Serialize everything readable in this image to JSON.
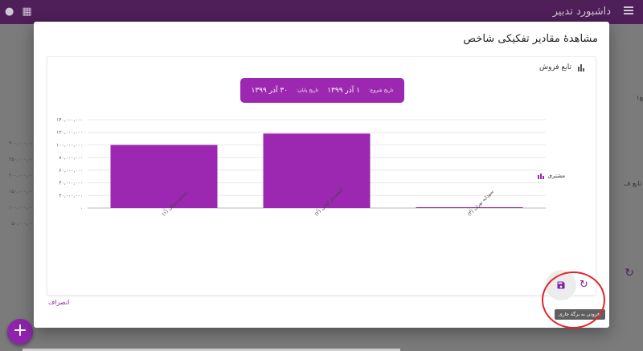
{
  "app": {
    "title": "داشبورد تدبیر",
    "menu_icon": "menu-icon",
    "left_icons": [
      "user-icon",
      "apps-icon"
    ]
  },
  "background": {
    "axis_labels": [
      "۳۰۰,۰۰۰,۰۰۰",
      "۲۵۰,۰۰۰,۰۰۰",
      "۲۰۰,۰۰۰,۰۰۰",
      "۱۵۰,۰۰۰,۰۰۰",
      "۱۰۰,۰۰۰,۰۰۰",
      "۵۰,۰۰۰,۰۰۰"
    ],
    "right_text_1": "۱‍ع",
    "right_text_2": "تابع ف",
    "fab_label": "+"
  },
  "dialog": {
    "title": "مشاهدهٔ مقادیر تفکیکی شاخص",
    "card_title": "تابع فروش",
    "date_range": {
      "start_label": "تاریخ شروع:",
      "start_value": "۱ آذر ۱۳۹۹",
      "end_label": "تاریخ پایان:",
      "end_value": "۳۰ آذر ۱۳۹۹"
    },
    "legend_label": "مشتری",
    "tooltip": "افزودن به برگهٔ جاری",
    "cancel_label": "انصراف",
    "accent_color": "#9c27b0"
  },
  "chart_data": {
    "type": "bar",
    "categories": [
      "رستم دستان (۱)",
      "اسفندیار کیانی (۲)",
      "سودابه توران (۳)"
    ],
    "values": [
      100000000,
      118000000,
      1000000
    ],
    "y_ticks": [
      0,
      20000000,
      40000000,
      60000000,
      80000000,
      100000000,
      120000000,
      140000000
    ],
    "y_tick_labels": [
      "۰",
      "۲۰,۰۰۰,۰۰۰",
      "۴۰,۰۰۰,۰۰۰",
      "۶۰,۰۰۰,۰۰۰",
      "۸۰,۰۰۰,۰۰۰",
      "۱۰۰,۰۰۰,۰۰۰",
      "۱۲۰,۰۰۰,۰۰۰",
      "۱۴۰,۰۰۰,۰۰۰"
    ],
    "ylim": [
      0,
      140000000
    ],
    "grid": true,
    "legend_position": "right",
    "color": "#9c27b0",
    "series": [
      {
        "name": "مشتری",
        "values": [
          100000000,
          118000000,
          1000000
        ]
      }
    ]
  }
}
